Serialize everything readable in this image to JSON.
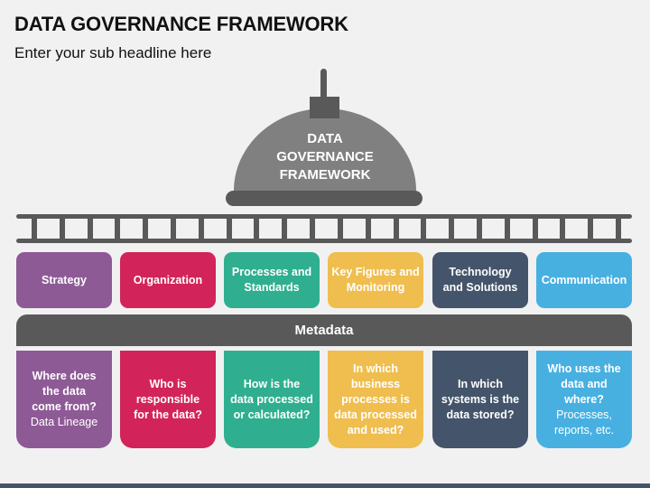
{
  "header": {
    "title": "DATA GOVERNANCE FRAMEWORK",
    "subtitle": "Enter your sub headline here"
  },
  "dome": {
    "label": "DATA\nGOVERNANCE\nFRAMEWORK",
    "lines": [
      "DATA",
      "GOVERNANCE",
      "FRAMEWORK"
    ],
    "color": "#808080",
    "accent": "#595959"
  },
  "ladder": {
    "rung_count": 22,
    "color": "#595959"
  },
  "pillars": [
    {
      "label": "Strategy",
      "color": "#8e5a96",
      "question": "Where does\nthe data\ncome from?",
      "note": "Data Lineage"
    },
    {
      "label": "Organization",
      "color": "#d2245a",
      "question": "Who is\nresponsible\nfor the data?",
      "note": ""
    },
    {
      "label": "Processes and\nStandards",
      "color": "#2faf8f",
      "question": "How is the\ndata processed\nor calculated?",
      "note": ""
    },
    {
      "label": "Key Figures and\nMonitoring",
      "color": "#efbe4f",
      "question": "In which\nbusiness\nprocesses is\ndata processed\nand used?",
      "note": ""
    },
    {
      "label": "Technology\nand Solutions",
      "color": "#44546a",
      "question": "In which\nsystems is the\ndata stored?",
      "note": ""
    },
    {
      "label": "Communication",
      "color": "#48b0e1",
      "question": "Who uses the\ndata and\nwhere?",
      "note": "Processes,\nreports, etc."
    }
  ],
  "metadata_bar": {
    "label": "Metadata",
    "color": "#595959"
  },
  "footer": {
    "color": "#44546a"
  }
}
